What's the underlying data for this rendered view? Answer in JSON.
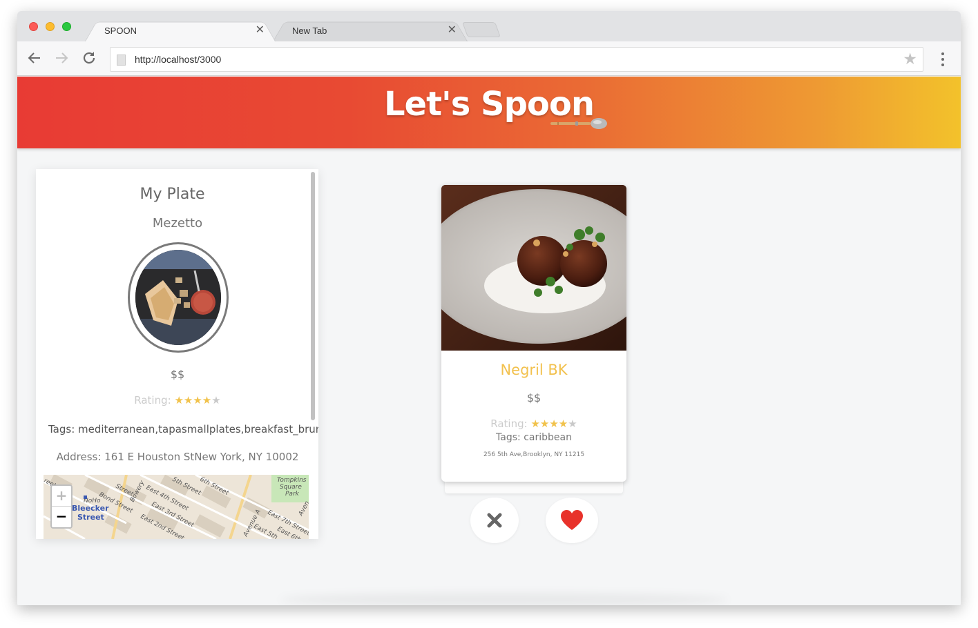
{
  "browser": {
    "tabs": [
      {
        "label": "SPOON",
        "close_glyph": "✕"
      },
      {
        "label": "New Tab",
        "close_glyph": "✕"
      }
    ],
    "url": "http://localhost/3000",
    "icons": [
      "back-arrow-icon",
      "forward-arrow-icon",
      "reload-icon",
      "page-icon",
      "bookmark-star-icon",
      "kebab-menu-icon"
    ]
  },
  "header": {
    "brand": "Let's Spoon",
    "gradient_colors": [
      "#e83b34",
      "#ea6b34",
      "#f3c22b"
    ]
  },
  "my_plate": {
    "title": "My Plate",
    "restaurant": "Mezetto",
    "price": "$$",
    "rating_label": "Rating:",
    "rating_value": 4,
    "rating_max": 5,
    "tags": "Tags: mediterranean,tapasmallplates,breakfast_brunch",
    "address": "Address: 161 E Houston StNew York, NY 10002",
    "map": {
      "zoom_in": "+",
      "zoom_out": "−",
      "labels": [
        "NoHo",
        "Bleecker",
        "Street",
        "Bond Street",
        "Bowery",
        "East 4th Street",
        "East 3rd Street",
        "East 2nd Street",
        "5th Street",
        "6th Street",
        "East 7th Street",
        "Tompkins",
        "Square",
        "Park",
        "Avenue A",
        "East 5th",
        "Street"
      ]
    }
  },
  "candidate_card": {
    "name": "Negril BK",
    "price": "$$",
    "rating_label": "Rating:",
    "rating_value": 4,
    "rating_max": 5,
    "tags": "Tags: caribbean",
    "address": "256 5th Ave,Brooklyn, NY 11215",
    "accent_color": "#f2c14e"
  },
  "actions": {
    "reject_icon": "close-x-icon",
    "like_icon": "heart-icon",
    "like_color": "#e8322b",
    "reject_color": "#666666"
  }
}
